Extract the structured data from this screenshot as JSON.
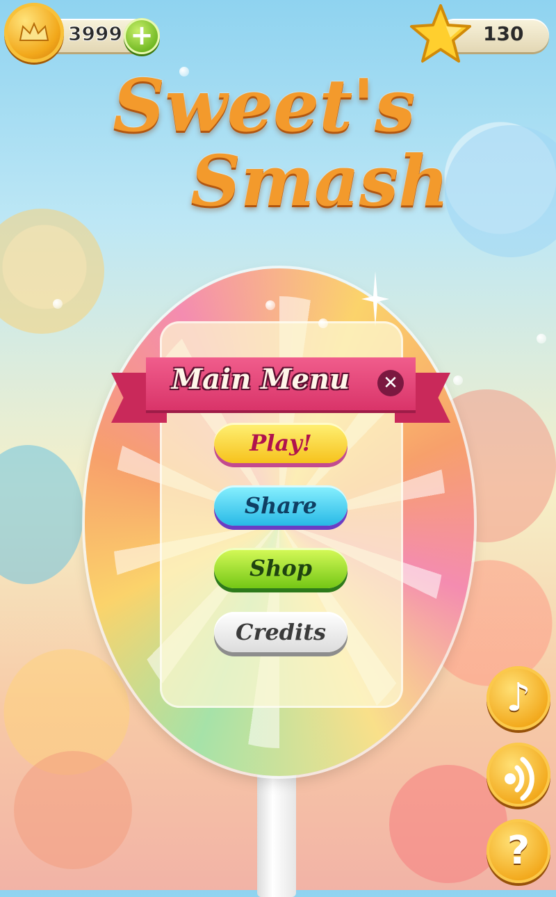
{
  "top_bar": {
    "coin_icon": "crown-coin-icon",
    "coin_count": "3999",
    "add_coins_icon": "plus-icon",
    "star_icon": "star-icon",
    "star_count": "130"
  },
  "title": {
    "line1": "Sweet's",
    "line2": "Smash"
  },
  "main_menu": {
    "title": "Main Menu",
    "close_icon": "close-icon",
    "buttons": [
      {
        "label": "Play!"
      },
      {
        "label": "Share"
      },
      {
        "label": "Shop"
      },
      {
        "label": "Credits"
      }
    ]
  },
  "side_buttons": {
    "music_icon": "music-note-icon",
    "sound_icon": "sound-icon",
    "help_label": "?"
  },
  "colors": {
    "title_orange": "#f39a2c",
    "ribbon_pink": "#e04474",
    "play_yellow": "#f6c21c",
    "share_cyan": "#28b9e6",
    "shop_green": "#74c715",
    "credits_white": "#dcdcdc",
    "coin_gold": "#f2a81b"
  }
}
